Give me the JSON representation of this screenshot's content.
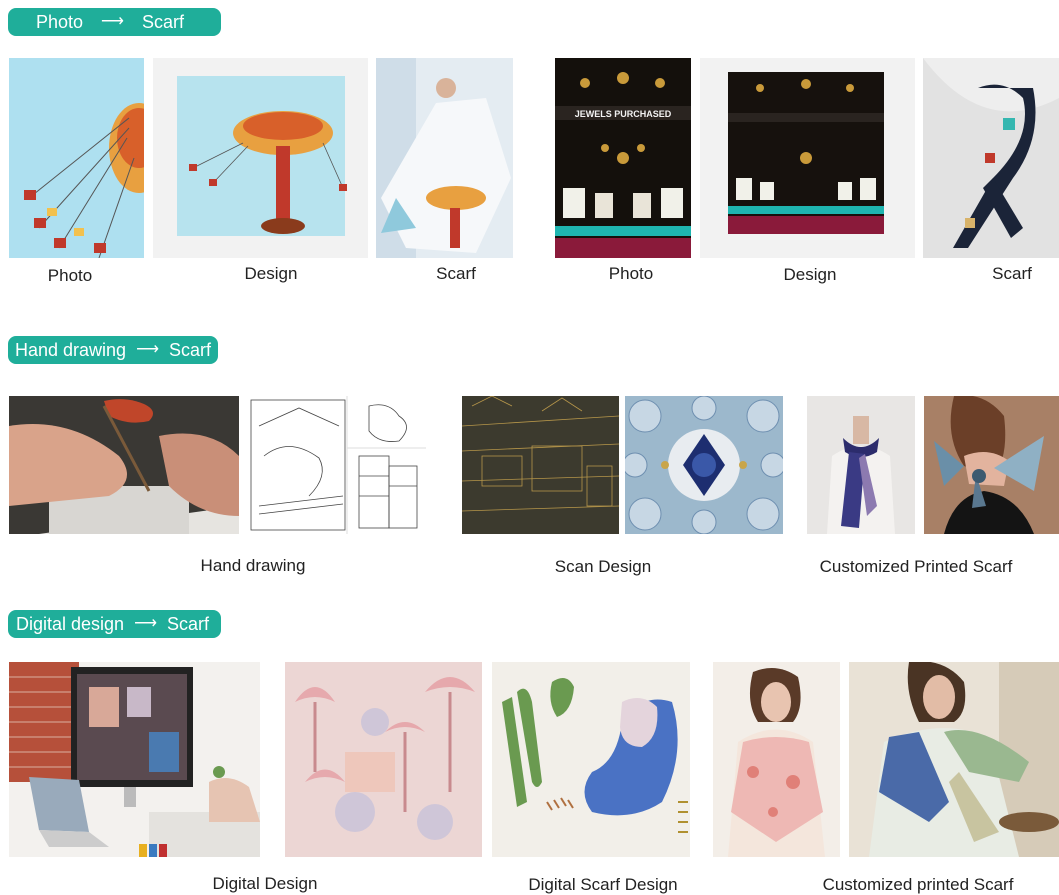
{
  "sections": [
    {
      "label_from": "Photo",
      "arrow": "⟶",
      "label_to": "Scarf"
    },
    {
      "label_from": "Hand drawing",
      "arrow": "⟶",
      "label_to": "Scarf"
    },
    {
      "label_from": "Digital design",
      "arrow": "⟶",
      "label_to": "Scarf"
    }
  ],
  "row1": {
    "captions": [
      "Photo",
      "Design",
      "Scarf",
      "Photo",
      "Design",
      "Scarf"
    ],
    "sign_text": "JEWELS PURCHASED"
  },
  "row2": {
    "captions": [
      "Hand drawing",
      "Scan Design",
      "Customized Printed Scarf"
    ]
  },
  "row3": {
    "captions": [
      "Digital Design",
      "Digital Scarf Design",
      "Customized printed Scarf"
    ]
  },
  "colors": {
    "accent": "#1fae9a"
  }
}
